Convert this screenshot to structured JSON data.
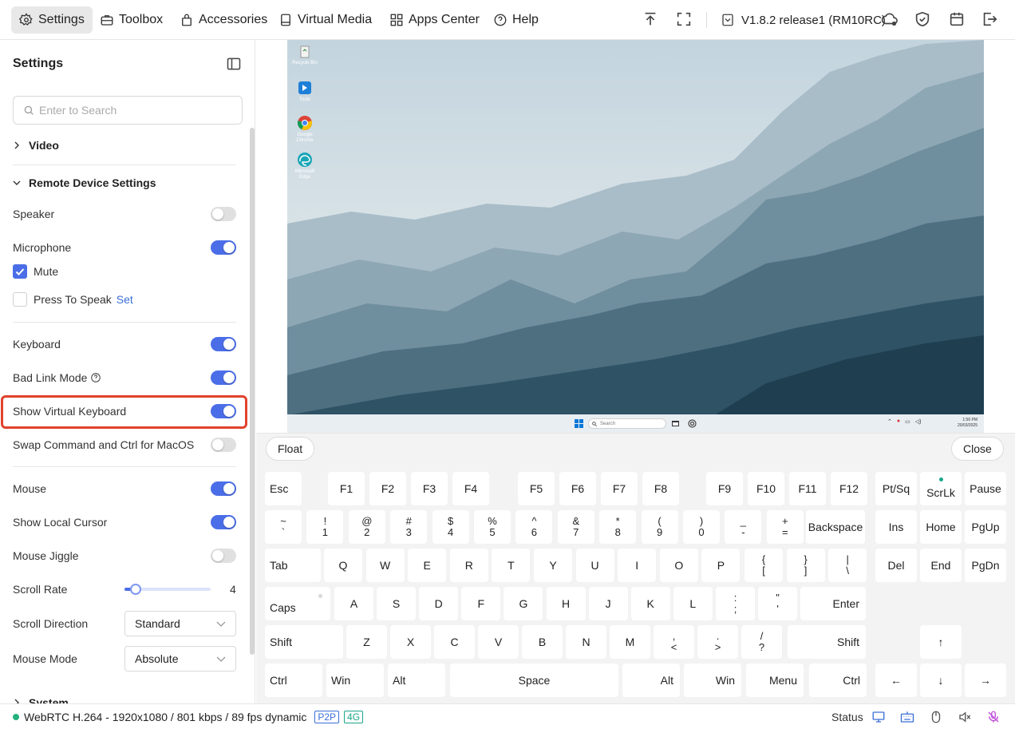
{
  "topbar": {
    "nav": [
      {
        "label": "Settings",
        "icon": "gear-icon",
        "active": true
      },
      {
        "label": "Toolbox",
        "icon": "toolbox-icon"
      },
      {
        "label": "Accessories",
        "icon": "bag-icon"
      },
      {
        "label": "Virtual Media",
        "icon": "media-icon"
      },
      {
        "label": "Apps Center",
        "icon": "apps-icon"
      },
      {
        "label": "Help",
        "icon": "help-icon"
      }
    ],
    "version": "V1.8.2 release1 (RM10RC)"
  },
  "sidebar": {
    "title": "Settings",
    "search_placeholder": "Enter to Search",
    "sections": {
      "video": "Video",
      "remote": "Remote Device Settings",
      "system": "System"
    },
    "rows": {
      "speaker": "Speaker",
      "microphone": "Microphone",
      "mute": "Mute",
      "press_to_speak": "Press To Speak",
      "set_link": "Set",
      "keyboard": "Keyboard",
      "bad_link": "Bad Link Mode",
      "virtual_keyboard": "Show Virtual Keyboard",
      "swap_cmd": "Swap Command and Ctrl for MacOS",
      "mouse": "Mouse",
      "local_cursor": "Show Local Cursor",
      "mouse_jiggle": "Mouse Jiggle",
      "scroll_rate": "Scroll Rate",
      "scroll_rate_value": "4",
      "scroll_direction": "Scroll Direction",
      "scroll_direction_value": "Standard",
      "mouse_mode": "Mouse Mode",
      "mouse_mode_value": "Absolute"
    },
    "toggles": {
      "speaker": false,
      "microphone": true,
      "keyboard": true,
      "bad_link": true,
      "virtual_keyboard": true,
      "swap_cmd": false,
      "mouse": true,
      "local_cursor": true,
      "mouse_jiggle": false
    },
    "scroll_rate_fraction": 0.13
  },
  "desktop": {
    "icons": [
      {
        "label": "Recycle Bin"
      },
      {
        "label": "Tools"
      },
      {
        "label": "Google Chrome"
      },
      {
        "label": "Microsoft Edge"
      }
    ],
    "taskbar_search": "Search",
    "clock_time": "1:56 PM",
    "clock_date": "20/03/2025"
  },
  "keyboard": {
    "float_label": "Float",
    "close_label": "Close",
    "keys": {
      "esc": "Esc",
      "f1": "F1",
      "f2": "F2",
      "f3": "F3",
      "f4": "F4",
      "f5": "F5",
      "f6": "F6",
      "f7": "F7",
      "f8": "F8",
      "f9": "F9",
      "f10": "F10",
      "f11": "F11",
      "f12": "F12",
      "ptsq": "Pt/Sq",
      "scrlk": "ScrLk",
      "pause": "Pause",
      "backspace": "Backspace",
      "ins": "Ins",
      "home": "Home",
      "pgup": "PgUp",
      "tab": "Tab",
      "del": "Del",
      "end": "End",
      "pgdn": "PgDn",
      "caps": "Caps",
      "enter": "Enter",
      "shift": "Shift",
      "up": "↑",
      "ctrl": "Ctrl",
      "win": "Win",
      "alt": "Alt",
      "space": "Space",
      "menu": "Menu",
      "left": "←",
      "down": "↓",
      "right": "→"
    },
    "num_row": [
      {
        "top": "~",
        "bot": "`"
      },
      {
        "top": "!",
        "bot": "1"
      },
      {
        "top": "@",
        "bot": "2"
      },
      {
        "top": "#",
        "bot": "3"
      },
      {
        "top": "$",
        "bot": "4"
      },
      {
        "top": "%",
        "bot": "5"
      },
      {
        "top": "^",
        "bot": "6"
      },
      {
        "top": "&",
        "bot": "7"
      },
      {
        "top": "*",
        "bot": "8"
      },
      {
        "top": "(",
        "bot": "9"
      },
      {
        "top": ")",
        "bot": "0"
      },
      {
        "top": "_",
        "bot": "-"
      },
      {
        "top": "+",
        "bot": "="
      }
    ],
    "q_row": [
      "Q",
      "W",
      "E",
      "R",
      "T",
      "Y",
      "U",
      "I",
      "O",
      "P"
    ],
    "q_row_sym": [
      {
        "top": "{",
        "bot": "["
      },
      {
        "top": "}",
        "bot": "]"
      },
      {
        "top": "|",
        "bot": "\\"
      }
    ],
    "a_row": [
      "A",
      "S",
      "D",
      "F",
      "G",
      "H",
      "J",
      "K",
      "L"
    ],
    "a_row_sym": [
      {
        "top": ":",
        "bot": ";"
      },
      {
        "top": "\"",
        "bot": "'"
      }
    ],
    "z_row": [
      "Z",
      "X",
      "C",
      "V",
      "B",
      "N",
      "M"
    ],
    "z_row_sym": [
      {
        "top": ",",
        "bot": "<"
      },
      {
        "top": ".",
        "bot": ">"
      },
      {
        "top": "/",
        "bot": "?"
      }
    ]
  },
  "statusbar": {
    "connection": "WebRTC H.264 - 1920x1080 /  801 kbps / 89 fps dynamic",
    "tag_p2p": "P2P",
    "tag_4g": "4G",
    "status_label": "Status",
    "colors": {
      "p2p": "#3a6fd8",
      "4g": "#1aa68a",
      "online": "#23b07d",
      "muted": "#c04bd8"
    }
  }
}
